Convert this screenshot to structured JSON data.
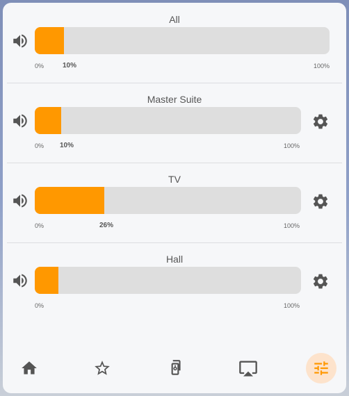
{
  "zones": [
    {
      "name": "All",
      "volume_pct": 10,
      "volume_label": "10%",
      "min_label": "0%",
      "max_label": "100%",
      "has_settings": false
    },
    {
      "name": "Master Suite",
      "volume_pct": 10,
      "volume_label": "10%",
      "min_label": "0%",
      "max_label": "100%",
      "has_settings": true
    },
    {
      "name": "TV",
      "volume_pct": 26,
      "volume_label": "26%",
      "min_label": "0%",
      "max_label": "100%",
      "has_settings": true
    },
    {
      "name": "Hall",
      "volume_pct": 9,
      "volume_label": "",
      "min_label": "0%",
      "max_label": "100%",
      "has_settings": true
    }
  ],
  "nav": {
    "items": [
      "home-icon",
      "star-icon",
      "speaker-icon",
      "airplay-icon",
      "tune-icon"
    ],
    "active_index": 4
  },
  "colors": {
    "accent": "#ff9800",
    "track": "#dedede",
    "icon": "#555555",
    "active_icon": "#ff9800",
    "active_bg": "#fde3cc"
  }
}
